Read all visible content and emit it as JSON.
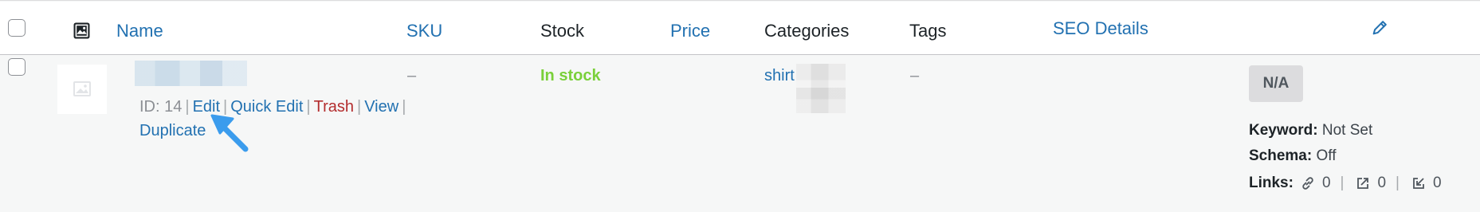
{
  "columns": {
    "name": "Name",
    "sku": "SKU",
    "stock": "Stock",
    "price": "Price",
    "categories": "Categories",
    "tags": "Tags",
    "seo_details": "SEO Details"
  },
  "row": {
    "sku": "–",
    "stock": "In stock",
    "category": "shirt",
    "tags": "–",
    "actions": {
      "id_label": "ID: 14",
      "edit": "Edit",
      "quick_edit": "Quick Edit",
      "trash": "Trash",
      "view": "View",
      "duplicate": "Duplicate"
    },
    "seo": {
      "score_badge": "N/A",
      "keyword_label": "Keyword:",
      "keyword_value": "Not Set",
      "schema_label": "Schema:",
      "schema_value": "Off",
      "links_label": "Links:",
      "internal_links": "0",
      "external_links": "0",
      "incoming_links": "0"
    }
  },
  "colors": {
    "link": "#2271b1",
    "in_stock": "#7ad03a",
    "trash": "#b32d2e",
    "arrow": "#3b9ced"
  },
  "icons": {
    "image_column": "image-icon",
    "thumbnail_placeholder": "image-placeholder-icon",
    "seo_edit": "pencil-icon",
    "internal_links": "link-icon",
    "external_links": "external-link-icon",
    "incoming_links": "incoming-link-icon",
    "annotation": "arrow-icon"
  }
}
